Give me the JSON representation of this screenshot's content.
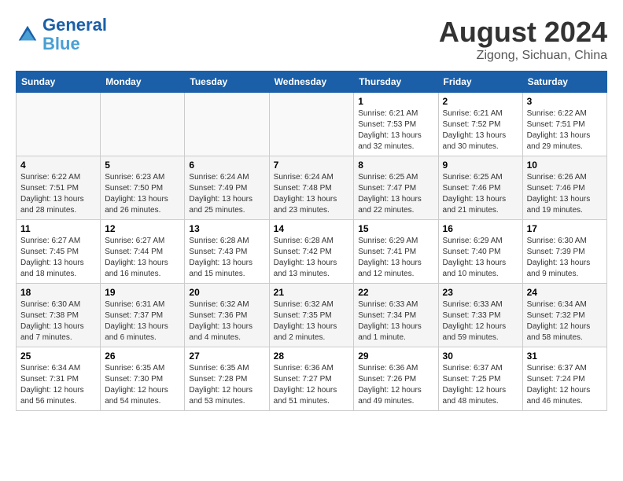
{
  "header": {
    "logo_line1": "General",
    "logo_line2": "Blue",
    "title": "August 2024",
    "subtitle": "Zigong, Sichuan, China"
  },
  "days_of_week": [
    "Sunday",
    "Monday",
    "Tuesday",
    "Wednesday",
    "Thursday",
    "Friday",
    "Saturday"
  ],
  "weeks": [
    [
      {
        "day": "",
        "info": ""
      },
      {
        "day": "",
        "info": ""
      },
      {
        "day": "",
        "info": ""
      },
      {
        "day": "",
        "info": ""
      },
      {
        "day": "1",
        "info": "Sunrise: 6:21 AM\nSunset: 7:53 PM\nDaylight: 13 hours and 32 minutes."
      },
      {
        "day": "2",
        "info": "Sunrise: 6:21 AM\nSunset: 7:52 PM\nDaylight: 13 hours and 30 minutes."
      },
      {
        "day": "3",
        "info": "Sunrise: 6:22 AM\nSunset: 7:51 PM\nDaylight: 13 hours and 29 minutes."
      }
    ],
    [
      {
        "day": "4",
        "info": "Sunrise: 6:22 AM\nSunset: 7:51 PM\nDaylight: 13 hours and 28 minutes."
      },
      {
        "day": "5",
        "info": "Sunrise: 6:23 AM\nSunset: 7:50 PM\nDaylight: 13 hours and 26 minutes."
      },
      {
        "day": "6",
        "info": "Sunrise: 6:24 AM\nSunset: 7:49 PM\nDaylight: 13 hours and 25 minutes."
      },
      {
        "day": "7",
        "info": "Sunrise: 6:24 AM\nSunset: 7:48 PM\nDaylight: 13 hours and 23 minutes."
      },
      {
        "day": "8",
        "info": "Sunrise: 6:25 AM\nSunset: 7:47 PM\nDaylight: 13 hours and 22 minutes."
      },
      {
        "day": "9",
        "info": "Sunrise: 6:25 AM\nSunset: 7:46 PM\nDaylight: 13 hours and 21 minutes."
      },
      {
        "day": "10",
        "info": "Sunrise: 6:26 AM\nSunset: 7:46 PM\nDaylight: 13 hours and 19 minutes."
      }
    ],
    [
      {
        "day": "11",
        "info": "Sunrise: 6:27 AM\nSunset: 7:45 PM\nDaylight: 13 hours and 18 minutes."
      },
      {
        "day": "12",
        "info": "Sunrise: 6:27 AM\nSunset: 7:44 PM\nDaylight: 13 hours and 16 minutes."
      },
      {
        "day": "13",
        "info": "Sunrise: 6:28 AM\nSunset: 7:43 PM\nDaylight: 13 hours and 15 minutes."
      },
      {
        "day": "14",
        "info": "Sunrise: 6:28 AM\nSunset: 7:42 PM\nDaylight: 13 hours and 13 minutes."
      },
      {
        "day": "15",
        "info": "Sunrise: 6:29 AM\nSunset: 7:41 PM\nDaylight: 13 hours and 12 minutes."
      },
      {
        "day": "16",
        "info": "Sunrise: 6:29 AM\nSunset: 7:40 PM\nDaylight: 13 hours and 10 minutes."
      },
      {
        "day": "17",
        "info": "Sunrise: 6:30 AM\nSunset: 7:39 PM\nDaylight: 13 hours and 9 minutes."
      }
    ],
    [
      {
        "day": "18",
        "info": "Sunrise: 6:30 AM\nSunset: 7:38 PM\nDaylight: 13 hours and 7 minutes."
      },
      {
        "day": "19",
        "info": "Sunrise: 6:31 AM\nSunset: 7:37 PM\nDaylight: 13 hours and 6 minutes."
      },
      {
        "day": "20",
        "info": "Sunrise: 6:32 AM\nSunset: 7:36 PM\nDaylight: 13 hours and 4 minutes."
      },
      {
        "day": "21",
        "info": "Sunrise: 6:32 AM\nSunset: 7:35 PM\nDaylight: 13 hours and 2 minutes."
      },
      {
        "day": "22",
        "info": "Sunrise: 6:33 AM\nSunset: 7:34 PM\nDaylight: 13 hours and 1 minute."
      },
      {
        "day": "23",
        "info": "Sunrise: 6:33 AM\nSunset: 7:33 PM\nDaylight: 12 hours and 59 minutes."
      },
      {
        "day": "24",
        "info": "Sunrise: 6:34 AM\nSunset: 7:32 PM\nDaylight: 12 hours and 58 minutes."
      }
    ],
    [
      {
        "day": "25",
        "info": "Sunrise: 6:34 AM\nSunset: 7:31 PM\nDaylight: 12 hours and 56 minutes."
      },
      {
        "day": "26",
        "info": "Sunrise: 6:35 AM\nSunset: 7:30 PM\nDaylight: 12 hours and 54 minutes."
      },
      {
        "day": "27",
        "info": "Sunrise: 6:35 AM\nSunset: 7:28 PM\nDaylight: 12 hours and 53 minutes."
      },
      {
        "day": "28",
        "info": "Sunrise: 6:36 AM\nSunset: 7:27 PM\nDaylight: 12 hours and 51 minutes."
      },
      {
        "day": "29",
        "info": "Sunrise: 6:36 AM\nSunset: 7:26 PM\nDaylight: 12 hours and 49 minutes."
      },
      {
        "day": "30",
        "info": "Sunrise: 6:37 AM\nSunset: 7:25 PM\nDaylight: 12 hours and 48 minutes."
      },
      {
        "day": "31",
        "info": "Sunrise: 6:37 AM\nSunset: 7:24 PM\nDaylight: 12 hours and 46 minutes."
      }
    ]
  ]
}
